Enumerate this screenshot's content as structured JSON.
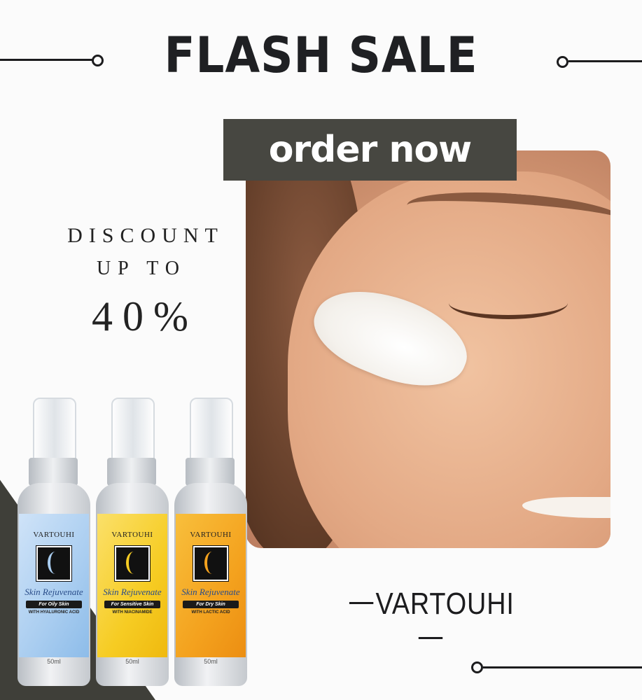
{
  "headline": "FLASH SALE",
  "cta": {
    "label": "order now"
  },
  "discount": {
    "line1": "DISCOUNT",
    "line2": "UP TO",
    "amount": "40%"
  },
  "brand": "VARTOUHI",
  "products": [
    {
      "brand": "VARTOUHI",
      "name": "Skin Rejuvenate",
      "for": "For Oily Skin",
      "with": "WITH HYALURONIC ACID",
      "volume": "50ml",
      "color": "#a9cdf0"
    },
    {
      "brand": "VARTOUHI",
      "name": "Skin Rejuvenate",
      "for": "For Sensitive Skin",
      "with": "WITH NIACINAMIDE",
      "volume": "50ml",
      "color": "#f6cc23"
    },
    {
      "brand": "VARTOUHI",
      "name": "Skin Rejuvenate",
      "for": "For Dry Skin",
      "with": "WITH LACTIC ACID",
      "volume": "50ml",
      "color": "#f4a21e"
    }
  ],
  "colors": {
    "banner": "#474741",
    "text": "#1f2023",
    "corner": "#3f3f39"
  }
}
